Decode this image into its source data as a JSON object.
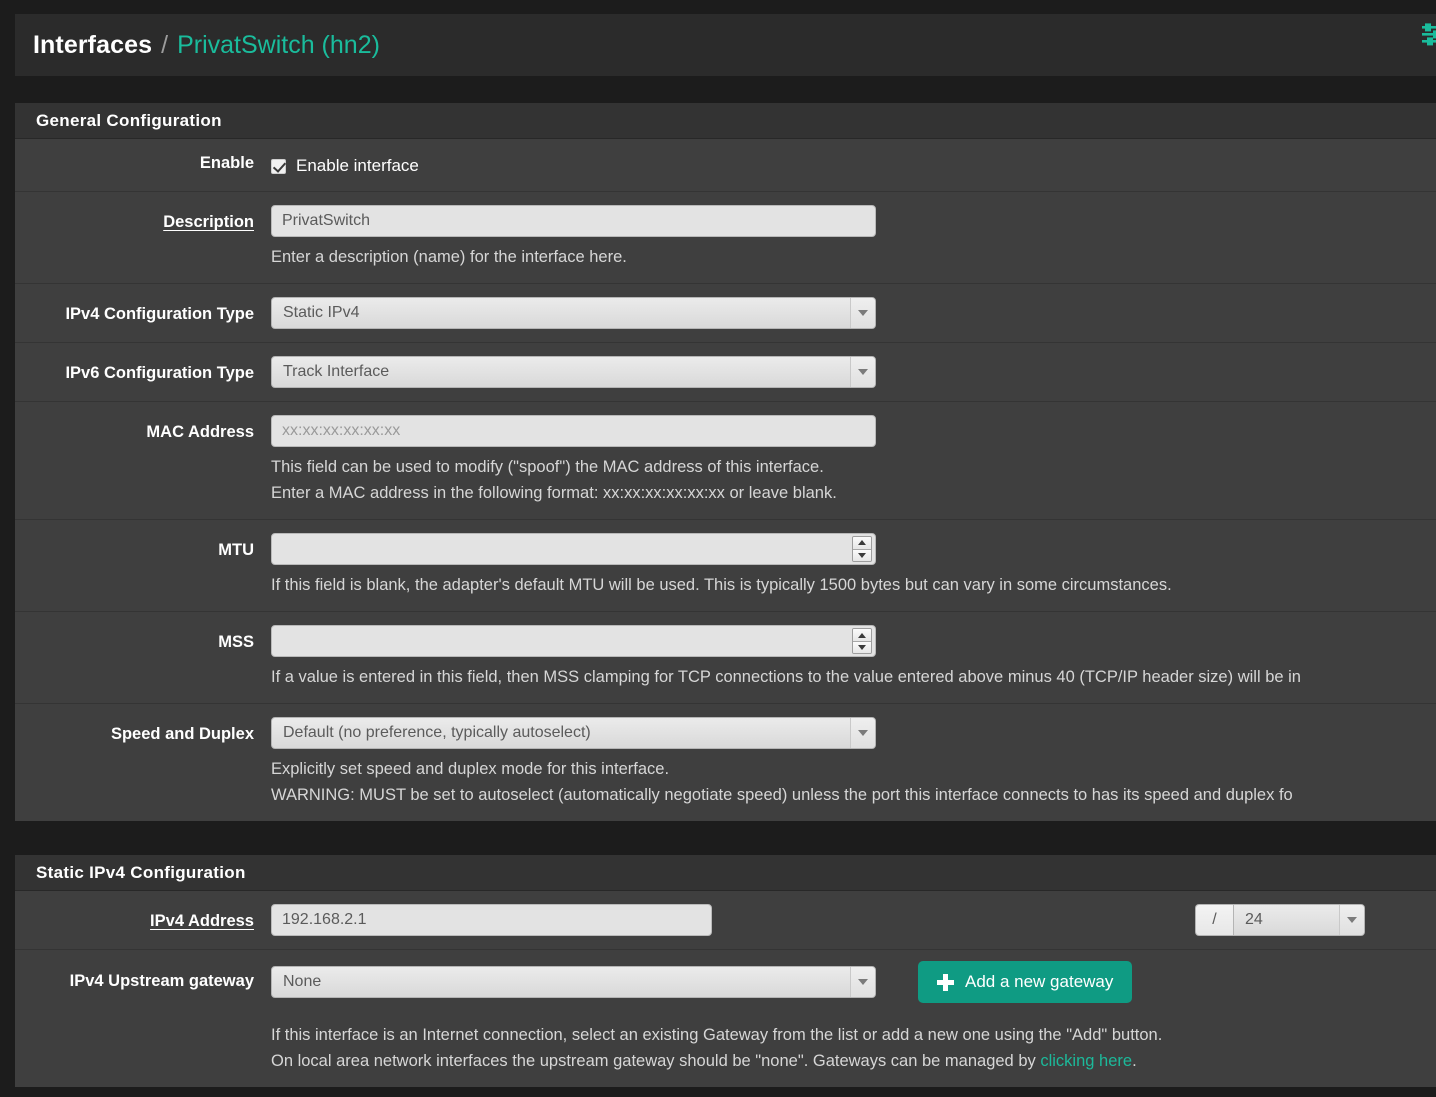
{
  "breadcrumb": {
    "root": "Interfaces",
    "separator": "/",
    "current": "PrivatSwitch (hn2)",
    "tools_icon": "sliders-icon"
  },
  "general_panel": {
    "title": "General Configuration",
    "enable": {
      "label": "Enable",
      "checkbox_label": "Enable interface",
      "checked": true
    },
    "description": {
      "label": "Description",
      "value": "PrivatSwitch",
      "help": "Enter a description (name) for the interface here."
    },
    "ipv4_config_type": {
      "label": "IPv4 Configuration Type",
      "value": "Static IPv4"
    },
    "ipv6_config_type": {
      "label": "IPv6 Configuration Type",
      "value": "Track Interface"
    },
    "mac_address": {
      "label": "MAC Address",
      "value": "",
      "placeholder": "xx:xx:xx:xx:xx:xx",
      "help_line1": "This field can be used to modify (\"spoof\") the MAC address of this interface.",
      "help_line2": "Enter a MAC address in the following format: xx:xx:xx:xx:xx:xx or leave blank."
    },
    "mtu": {
      "label": "MTU",
      "value": "",
      "help": "If this field is blank, the adapter's default MTU will be used. This is typically 1500 bytes but can vary in some circumstances."
    },
    "mss": {
      "label": "MSS",
      "value": "",
      "help": "If a value is entered in this field, then MSS clamping for TCP connections to the value entered above minus 40 (TCP/IP header size) will be in"
    },
    "speed_duplex": {
      "label": "Speed and Duplex",
      "value": "Default (no preference, typically autoselect)",
      "help_line1": "Explicitly set speed and duplex mode for this interface.",
      "help_line2": "WARNING: MUST be set to autoselect (automatically negotiate speed) unless the port this interface connects to has its speed and duplex fo"
    }
  },
  "static_ipv4_panel": {
    "title": "Static IPv4 Configuration",
    "ipv4_address": {
      "label": "IPv4 Address",
      "value": "192.168.2.1",
      "prefix_symbol": "/",
      "subnet_mask": "24"
    },
    "ipv4_gateway": {
      "label": "IPv4 Upstream gateway",
      "value": "None",
      "add_button_label": "Add a new gateway",
      "help_line1": "If this interface is an Internet connection, select an existing Gateway from the list or add a new one using the \"Add\" button.",
      "help_line2_pre": "On local area network interfaces the upstream gateway should be \"none\". Gateways can be managed by ",
      "help_line2_link": "clicking here",
      "help_line2_post": "."
    }
  },
  "colors": {
    "page_bg": "#1c1c1c",
    "panel_bg": "#3f3f3f",
    "panel_header_bg": "#333333",
    "accent_teal": "#1abc9c",
    "button_green": "#0f9b83",
    "control_bg": "#e3e3e3"
  }
}
